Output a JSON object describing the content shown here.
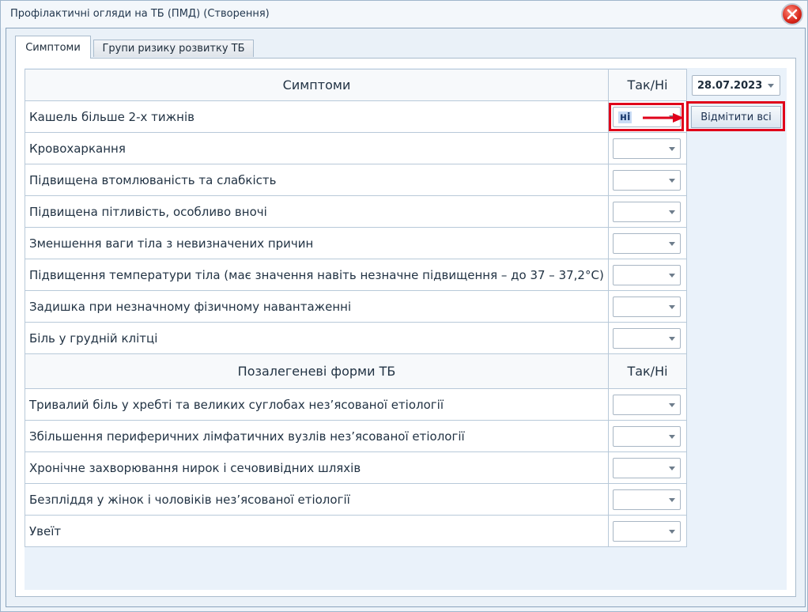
{
  "window": {
    "title": "Профілактичні огляди на ТБ (ПМД) (Створення)"
  },
  "tabs": [
    {
      "label": "Симптоми",
      "active": true
    },
    {
      "label": "Групи ризику розвитку ТБ",
      "active": false
    }
  ],
  "date": {
    "value": "28.07.2023"
  },
  "mark_all_label": "Відмітити всі",
  "sections": [
    {
      "header": "Симптоми",
      "col_header": "Так/Ні",
      "rows": [
        {
          "label": "Кашель більше 2-х тижнів",
          "value": "ні"
        },
        {
          "label": "Кровохаркання",
          "value": ""
        },
        {
          "label": "Підвищена втомлюваність та слабкість",
          "value": ""
        },
        {
          "label": "Підвищена пітливість, особливо вночі",
          "value": ""
        },
        {
          "label": "Зменшення ваги тіла з невизначених причин",
          "value": ""
        },
        {
          "label": "Підвищення температури тіла (має значення навіть незначне підвищення – до 37 – 37,2°С)",
          "value": ""
        },
        {
          "label": "Задишка при незначному фізичному навантаженні",
          "value": ""
        },
        {
          "label": "Біль у грудній клітці",
          "value": ""
        }
      ]
    },
    {
      "header": "Позалегеневі форми ТБ",
      "col_header": "Так/Ні",
      "rows": [
        {
          "label": "Тривалий біль у хребті та великих суглобах нез’ясованої етіології",
          "value": ""
        },
        {
          "label": "Збільшення периферичних лімфатичних вузлів нез’ясованої етіології",
          "value": ""
        },
        {
          "label": "Хронічне захворювання нирок і сечовивідних шляхів",
          "value": ""
        },
        {
          "label": "Безпліддя у жінок і чоловіків нез’ясованої етіології",
          "value": ""
        },
        {
          "label": "Увеїт",
          "value": ""
        }
      ]
    }
  ]
}
